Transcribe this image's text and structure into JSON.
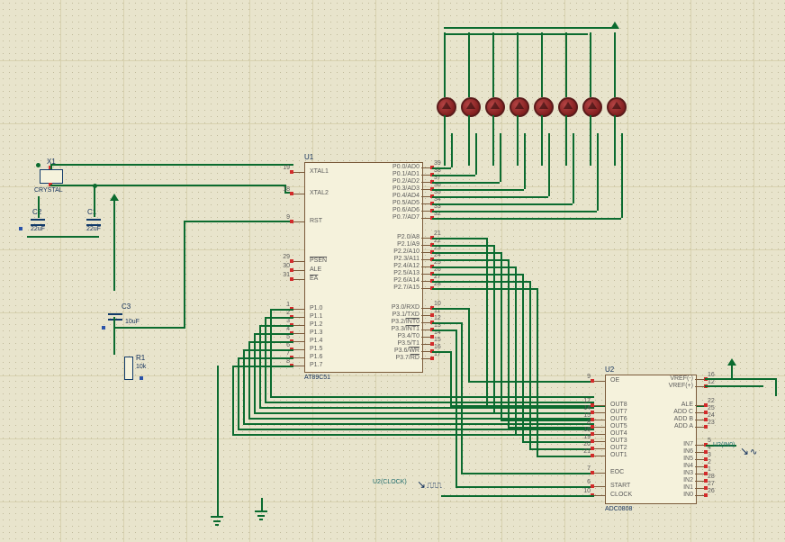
{
  "components": {
    "X1": {
      "ref": "X1",
      "value": "CRYSTAL"
    },
    "C1": {
      "ref": "C1",
      "value": "22uF"
    },
    "C2": {
      "ref": "C2",
      "value": "22uF"
    },
    "C3": {
      "ref": "C3",
      "value": "10uF"
    },
    "R1": {
      "ref": "R1",
      "value": "10k"
    },
    "U1": {
      "ref": "U1",
      "part": "AT89C51"
    },
    "U2": {
      "ref": "U2",
      "part": "ADC0808"
    }
  },
  "signals": {
    "clock": {
      "label": "U2(CLOCK)"
    },
    "in0": {
      "label": "U2(IN0)"
    }
  },
  "U1_pins": {
    "left": [
      {
        "num": "19",
        "name": "XTAL1"
      },
      {
        "num": "18",
        "name": "XTAL2"
      },
      {
        "num": "9",
        "name": "RST"
      },
      {
        "num": "29",
        "name": "PSEN",
        "over": true
      },
      {
        "num": "30",
        "name": "ALE"
      },
      {
        "num": "31",
        "name": "EA",
        "over": true
      },
      {
        "num": "1",
        "name": "P1.0"
      },
      {
        "num": "2",
        "name": "P1.1"
      },
      {
        "num": "3",
        "name": "P1.2"
      },
      {
        "num": "4",
        "name": "P1.3"
      },
      {
        "num": "5",
        "name": "P1.4"
      },
      {
        "num": "6",
        "name": "P1.5"
      },
      {
        "num": "7",
        "name": "P1.6"
      },
      {
        "num": "8",
        "name": "P1.7"
      }
    ],
    "right": [
      {
        "num": "39",
        "name": "P0.0/AD0"
      },
      {
        "num": "38",
        "name": "P0.1/AD1"
      },
      {
        "num": "37",
        "name": "P0.2/AD2"
      },
      {
        "num": "36",
        "name": "P0.3/AD3"
      },
      {
        "num": "35",
        "name": "P0.4/AD4"
      },
      {
        "num": "34",
        "name": "P0.5/AD5"
      },
      {
        "num": "33",
        "name": "P0.6/AD6"
      },
      {
        "num": "32",
        "name": "P0.7/AD7"
      },
      {
        "num": "21",
        "name": "P2.0/A8"
      },
      {
        "num": "22",
        "name": "P2.1/A9"
      },
      {
        "num": "23",
        "name": "P2.2/A10"
      },
      {
        "num": "24",
        "name": "P2.3/A11"
      },
      {
        "num": "25",
        "name": "P2.4/A12"
      },
      {
        "num": "26",
        "name": "P2.5/A13"
      },
      {
        "num": "27",
        "name": "P2.6/A14"
      },
      {
        "num": "28",
        "name": "P2.7/A15"
      },
      {
        "num": "10",
        "name": "P3.0/RXD"
      },
      {
        "num": "11",
        "name": "P3.1/TXD"
      },
      {
        "num": "12",
        "name": "P3.2/INT0",
        "over": "INT0"
      },
      {
        "num": "13",
        "name": "P3.3/INT1",
        "over": "INT1"
      },
      {
        "num": "14",
        "name": "P3.4/T0"
      },
      {
        "num": "15",
        "name": "P3.5/T1"
      },
      {
        "num": "16",
        "name": "P3.6/WR",
        "over": "WR"
      },
      {
        "num": "17",
        "name": "P3.7/RD",
        "over": "RD"
      }
    ]
  },
  "U2_pins": {
    "left": [
      {
        "num": "9",
        "name": "OE"
      },
      {
        "num": "17",
        "name": "OUT8"
      },
      {
        "num": "14",
        "name": "OUT7"
      },
      {
        "num": "15",
        "name": "OUT6"
      },
      {
        "num": "8",
        "name": "OUT5"
      },
      {
        "num": "18",
        "name": "OUT4"
      },
      {
        "num": "19",
        "name": "OUT3"
      },
      {
        "num": "20",
        "name": "OUT2"
      },
      {
        "num": "21",
        "name": "OUT1"
      },
      {
        "num": "7",
        "name": "EOC"
      },
      {
        "num": "6",
        "name": "START"
      },
      {
        "num": "10",
        "name": "CLOCK"
      }
    ],
    "right": [
      {
        "num": "16",
        "name": "VREF(-)"
      },
      {
        "num": "12",
        "name": "VREF(+)"
      },
      {
        "num": "22",
        "name": "ALE"
      },
      {
        "num": "25",
        "name": "ADD C"
      },
      {
        "num": "24",
        "name": "ADD B"
      },
      {
        "num": "23",
        "name": "ADD A"
      },
      {
        "num": "5",
        "name": "IN7"
      },
      {
        "num": "4",
        "name": "IN6"
      },
      {
        "num": "3",
        "name": "IN5"
      },
      {
        "num": "2",
        "name": "IN4"
      },
      {
        "num": "1",
        "name": "IN3"
      },
      {
        "num": "28",
        "name": "IN2"
      },
      {
        "num": "27",
        "name": "IN1"
      },
      {
        "num": "26",
        "name": "IN0"
      }
    ]
  },
  "led_count": 8
}
